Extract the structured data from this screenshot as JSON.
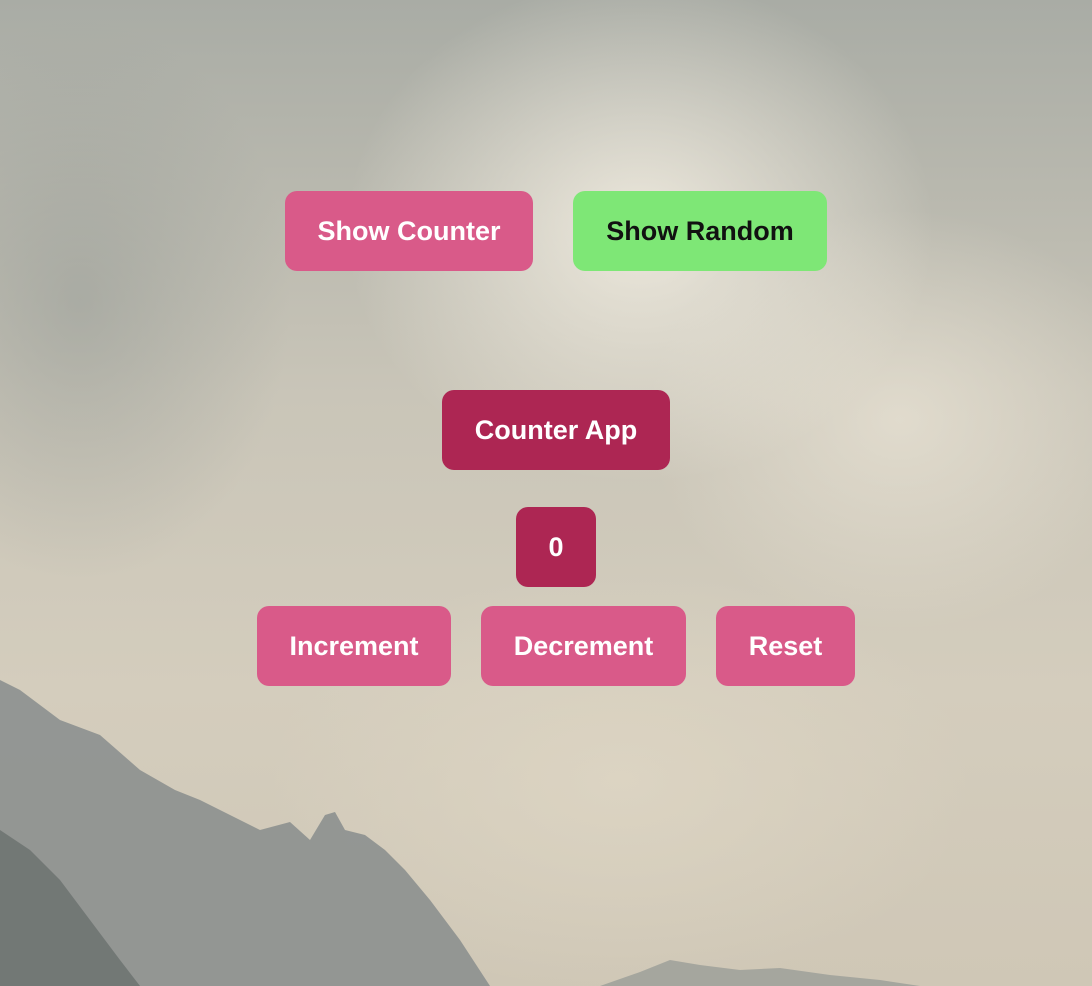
{
  "nav": {
    "show_counter_label": "Show Counter",
    "show_random_label": "Show Random"
  },
  "counter": {
    "title": "Counter App",
    "value": "0",
    "increment_label": "Increment",
    "decrement_label": "Decrement",
    "reset_label": "Reset"
  },
  "colors": {
    "button_pink": "#d95a89",
    "button_green": "#7ee776",
    "button_dark": "#ad2653"
  }
}
